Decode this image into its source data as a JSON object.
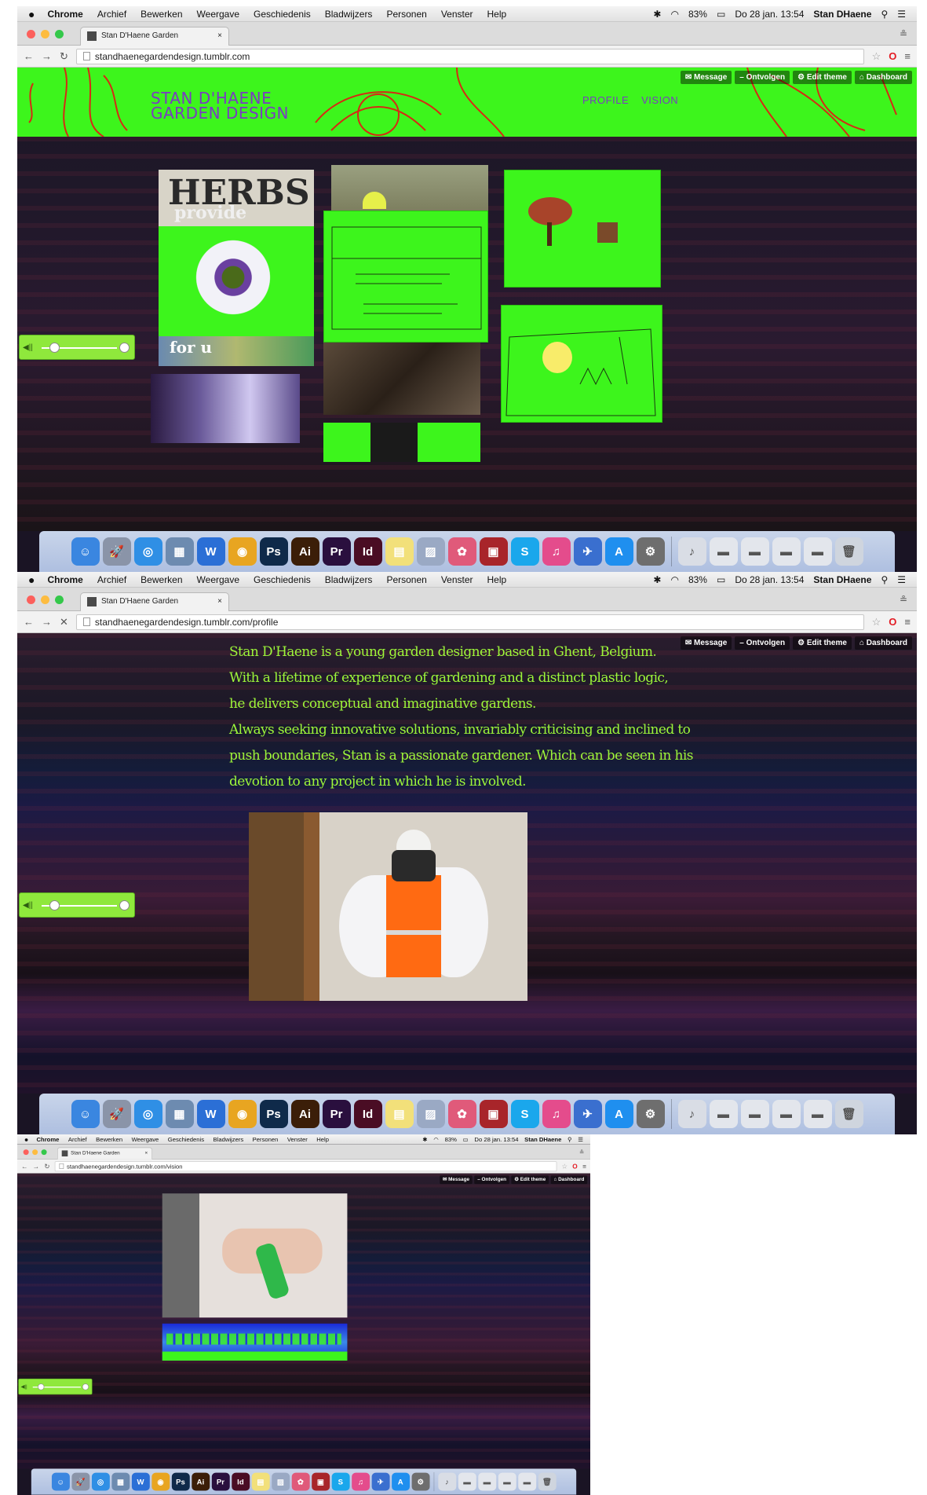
{
  "menubar": {
    "app": "Chrome",
    "items": [
      "Archief",
      "Bewerken",
      "Weergave",
      "Geschiedenis",
      "Bladwijzers",
      "Personen",
      "Venster",
      "Help"
    ],
    "battery": "83%",
    "datetime": "Do 28 jan. 13:54",
    "user": "Stan DHaene"
  },
  "browser": {
    "tab_title": "Stan D'Haene Garden",
    "url_home": "standhaenegardendesign.tumblr.com",
    "url_profile": "standhaenegardendesign.tumblr.com/profile",
    "url_vision": "standhaenegardendesign.tumblr.com/vision"
  },
  "tumblr_controls": {
    "message": "Message",
    "follow": "Ontvolgen",
    "edit_theme": "Edit theme",
    "dashboard": "Dashboard"
  },
  "site": {
    "title_line1": "STAN D'HAENE",
    "title_line2": "GARDEN DESIGN",
    "nav": [
      "PROFILE",
      "VISION"
    ],
    "card_text_1": "HERBS",
    "card_text_2": "provide",
    "card_text_3": "for u"
  },
  "profile": {
    "bio_lines": [
      "Stan D'Haene is a young garden designer based in Ghent, Belgium.",
      "With a lifetime of experience of gardening and a distinct plastic logic,",
      "he delivers conceptual and imaginative gardens.",
      "Always seeking innovative solutions, invariably criticising and inclined to",
      "push boundaries, Stan is a passionate gardener. Which can be seen in his",
      "devotion to any project in which he is involved."
    ]
  },
  "dock": {
    "apps": [
      {
        "name": "finder-icon",
        "glyph": "☺",
        "color": "#3a86e0"
      },
      {
        "name": "launchpad-icon",
        "glyph": "🚀",
        "color": "#8a94a8"
      },
      {
        "name": "safari-icon",
        "glyph": "◎",
        "color": "#2f8fe5"
      },
      {
        "name": "preview-icon",
        "glyph": "▦",
        "color": "#6d8bb0"
      },
      {
        "name": "word-icon",
        "glyph": "W",
        "color": "#2b6fd6"
      },
      {
        "name": "chrome-icon",
        "glyph": "◉",
        "color": "#e8a521"
      },
      {
        "name": "photoshop-icon",
        "glyph": "Ps",
        "color": "#0f2a4a"
      },
      {
        "name": "illustrator-icon",
        "glyph": "Ai",
        "color": "#3b1e08"
      },
      {
        "name": "premiere-icon",
        "glyph": "Pr",
        "color": "#2a0f3e"
      },
      {
        "name": "indesign-icon",
        "glyph": "Id",
        "color": "#4a0d24"
      },
      {
        "name": "notes-icon",
        "glyph": "▤",
        "color": "#f2e07a"
      },
      {
        "name": "photos-viewer-icon",
        "glyph": "▨",
        "color": "#9aa9c4"
      },
      {
        "name": "photos-icon",
        "glyph": "✿",
        "color": "#e05a7a"
      },
      {
        "name": "photo-booth-icon",
        "glyph": "▣",
        "color": "#a8252a"
      },
      {
        "name": "skype-icon",
        "glyph": "S",
        "color": "#1aa7ec"
      },
      {
        "name": "itunes-icon",
        "glyph": "♫",
        "color": "#e44c8c"
      },
      {
        "name": "bird-app-icon",
        "glyph": "✈",
        "color": "#3a6fcf"
      },
      {
        "name": "app-store-icon",
        "glyph": "A",
        "color": "#1f8fef"
      },
      {
        "name": "system-preferences-icon",
        "glyph": "⚙",
        "color": "#6e6e6e"
      }
    ],
    "right": [
      {
        "name": "music-folder-icon",
        "glyph": "♪",
        "color": "#d9dde5"
      },
      {
        "name": "document-stack-icon",
        "glyph": "▬",
        "color": "#e3e6ec"
      },
      {
        "name": "document-stack-icon",
        "glyph": "▬",
        "color": "#e3e6ec"
      },
      {
        "name": "document-stack-icon",
        "glyph": "▬",
        "color": "#e3e6ec"
      },
      {
        "name": "document-stack-icon",
        "glyph": "▬",
        "color": "#e3e6ec"
      },
      {
        "name": "trash-icon",
        "glyph": "🗑",
        "color": "#cfd5de"
      }
    ]
  },
  "colors": {
    "site_green": "#3df51c",
    "site_purple": "#7a3cc2",
    "bio_green": "#9df63a",
    "player_green": "#8fe83c"
  }
}
